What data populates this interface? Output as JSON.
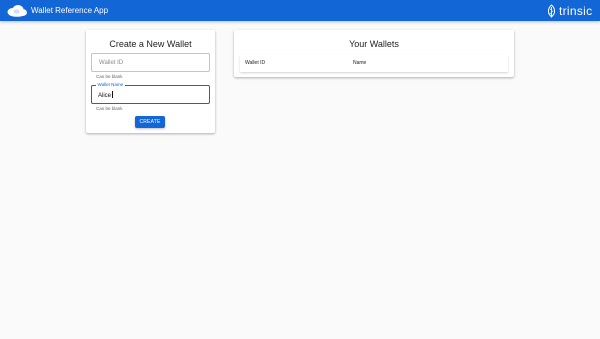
{
  "header": {
    "app_title": "Wallet Reference App",
    "brand_logo": "cloud-wallet-logo",
    "partner_logo_text": "trinsic",
    "partner_icon": "trinsic-leaf-icon",
    "color": "#1266d6"
  },
  "create_wallet": {
    "title": "Create a New Wallet",
    "wallet_id_placeholder": "Wallet ID",
    "wallet_id_helper": "Can be blank",
    "wallet_name_label": "Wallet Name",
    "wallet_name_value": "Alice",
    "wallet_name_helper": "Can be blank",
    "create_button": "CREATE"
  },
  "your_wallets": {
    "title": "Your Wallets",
    "columns": [
      "Wallet ID",
      "Name"
    ],
    "rows": []
  }
}
